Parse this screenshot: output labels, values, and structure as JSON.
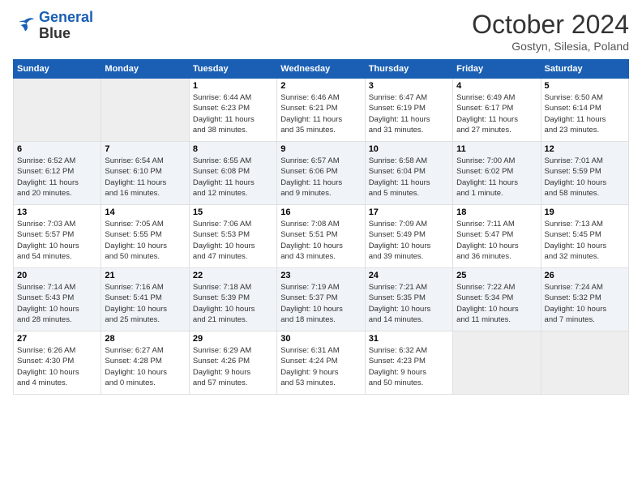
{
  "logo": {
    "line1": "General",
    "line2": "Blue"
  },
  "title": "October 2024",
  "subtitle": "Gostyn, Silesia, Poland",
  "days_of_week": [
    "Sunday",
    "Monday",
    "Tuesday",
    "Wednesday",
    "Thursday",
    "Friday",
    "Saturday"
  ],
  "weeks": [
    [
      {
        "num": "",
        "info": ""
      },
      {
        "num": "",
        "info": ""
      },
      {
        "num": "1",
        "info": "Sunrise: 6:44 AM\nSunset: 6:23 PM\nDaylight: 11 hours\nand 38 minutes."
      },
      {
        "num": "2",
        "info": "Sunrise: 6:46 AM\nSunset: 6:21 PM\nDaylight: 11 hours\nand 35 minutes."
      },
      {
        "num": "3",
        "info": "Sunrise: 6:47 AM\nSunset: 6:19 PM\nDaylight: 11 hours\nand 31 minutes."
      },
      {
        "num": "4",
        "info": "Sunrise: 6:49 AM\nSunset: 6:17 PM\nDaylight: 11 hours\nand 27 minutes."
      },
      {
        "num": "5",
        "info": "Sunrise: 6:50 AM\nSunset: 6:14 PM\nDaylight: 11 hours\nand 23 minutes."
      }
    ],
    [
      {
        "num": "6",
        "info": "Sunrise: 6:52 AM\nSunset: 6:12 PM\nDaylight: 11 hours\nand 20 minutes."
      },
      {
        "num": "7",
        "info": "Sunrise: 6:54 AM\nSunset: 6:10 PM\nDaylight: 11 hours\nand 16 minutes."
      },
      {
        "num": "8",
        "info": "Sunrise: 6:55 AM\nSunset: 6:08 PM\nDaylight: 11 hours\nand 12 minutes."
      },
      {
        "num": "9",
        "info": "Sunrise: 6:57 AM\nSunset: 6:06 PM\nDaylight: 11 hours\nand 9 minutes."
      },
      {
        "num": "10",
        "info": "Sunrise: 6:58 AM\nSunset: 6:04 PM\nDaylight: 11 hours\nand 5 minutes."
      },
      {
        "num": "11",
        "info": "Sunrise: 7:00 AM\nSunset: 6:02 PM\nDaylight: 11 hours\nand 1 minute."
      },
      {
        "num": "12",
        "info": "Sunrise: 7:01 AM\nSunset: 5:59 PM\nDaylight: 10 hours\nand 58 minutes."
      }
    ],
    [
      {
        "num": "13",
        "info": "Sunrise: 7:03 AM\nSunset: 5:57 PM\nDaylight: 10 hours\nand 54 minutes."
      },
      {
        "num": "14",
        "info": "Sunrise: 7:05 AM\nSunset: 5:55 PM\nDaylight: 10 hours\nand 50 minutes."
      },
      {
        "num": "15",
        "info": "Sunrise: 7:06 AM\nSunset: 5:53 PM\nDaylight: 10 hours\nand 47 minutes."
      },
      {
        "num": "16",
        "info": "Sunrise: 7:08 AM\nSunset: 5:51 PM\nDaylight: 10 hours\nand 43 minutes."
      },
      {
        "num": "17",
        "info": "Sunrise: 7:09 AM\nSunset: 5:49 PM\nDaylight: 10 hours\nand 39 minutes."
      },
      {
        "num": "18",
        "info": "Sunrise: 7:11 AM\nSunset: 5:47 PM\nDaylight: 10 hours\nand 36 minutes."
      },
      {
        "num": "19",
        "info": "Sunrise: 7:13 AM\nSunset: 5:45 PM\nDaylight: 10 hours\nand 32 minutes."
      }
    ],
    [
      {
        "num": "20",
        "info": "Sunrise: 7:14 AM\nSunset: 5:43 PM\nDaylight: 10 hours\nand 28 minutes."
      },
      {
        "num": "21",
        "info": "Sunrise: 7:16 AM\nSunset: 5:41 PM\nDaylight: 10 hours\nand 25 minutes."
      },
      {
        "num": "22",
        "info": "Sunrise: 7:18 AM\nSunset: 5:39 PM\nDaylight: 10 hours\nand 21 minutes."
      },
      {
        "num": "23",
        "info": "Sunrise: 7:19 AM\nSunset: 5:37 PM\nDaylight: 10 hours\nand 18 minutes."
      },
      {
        "num": "24",
        "info": "Sunrise: 7:21 AM\nSunset: 5:35 PM\nDaylight: 10 hours\nand 14 minutes."
      },
      {
        "num": "25",
        "info": "Sunrise: 7:22 AM\nSunset: 5:34 PM\nDaylight: 10 hours\nand 11 minutes."
      },
      {
        "num": "26",
        "info": "Sunrise: 7:24 AM\nSunset: 5:32 PM\nDaylight: 10 hours\nand 7 minutes."
      }
    ],
    [
      {
        "num": "27",
        "info": "Sunrise: 6:26 AM\nSunset: 4:30 PM\nDaylight: 10 hours\nand 4 minutes."
      },
      {
        "num": "28",
        "info": "Sunrise: 6:27 AM\nSunset: 4:28 PM\nDaylight: 10 hours\nand 0 minutes."
      },
      {
        "num": "29",
        "info": "Sunrise: 6:29 AM\nSunset: 4:26 PM\nDaylight: 9 hours\nand 57 minutes."
      },
      {
        "num": "30",
        "info": "Sunrise: 6:31 AM\nSunset: 4:24 PM\nDaylight: 9 hours\nand 53 minutes."
      },
      {
        "num": "31",
        "info": "Sunrise: 6:32 AM\nSunset: 4:23 PM\nDaylight: 9 hours\nand 50 minutes."
      },
      {
        "num": "",
        "info": ""
      },
      {
        "num": "",
        "info": ""
      }
    ]
  ]
}
